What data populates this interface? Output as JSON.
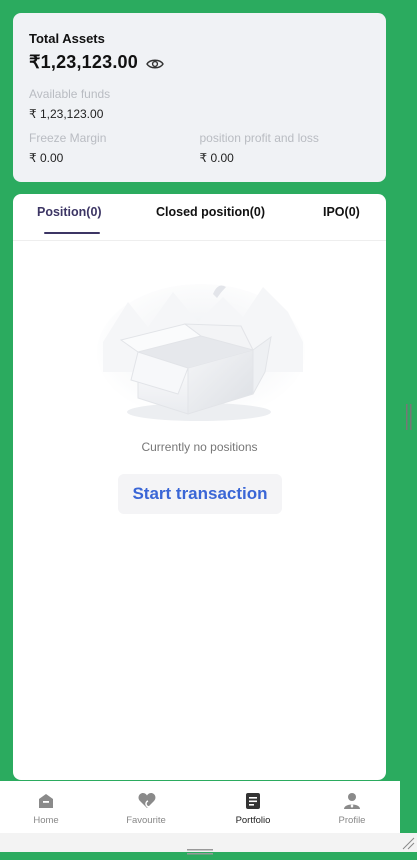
{
  "assets": {
    "title": "Total Assets",
    "total": "₹1,23,123.00",
    "available_label": "Available funds",
    "available_value": "₹ 1,23,123.00",
    "freeze_label": "Freeze Margin",
    "freeze_value": "₹ 0.00",
    "pnl_label": "position profit and loss",
    "pnl_value": "₹ 0.00"
  },
  "tabs": [
    {
      "label": "Position(0)",
      "active": true
    },
    {
      "label": "Closed position(0)",
      "active": false
    },
    {
      "label": "IPO(0)",
      "active": false
    }
  ],
  "empty": {
    "message": "Currently no positions",
    "button": "Start transaction",
    "illustration": "empty-box"
  },
  "nav": [
    {
      "label": "Home",
      "icon": "home-icon",
      "active": false
    },
    {
      "label": "Favourite",
      "icon": "heart-icon",
      "active": false
    },
    {
      "label": "Portfolio",
      "icon": "portfolio-icon",
      "active": true
    },
    {
      "label": "Profile",
      "icon": "profile-icon",
      "active": false
    }
  ],
  "colors": {
    "background": "#2bab5f",
    "accent": "#3c3564",
    "button_text": "#3a66d6"
  }
}
